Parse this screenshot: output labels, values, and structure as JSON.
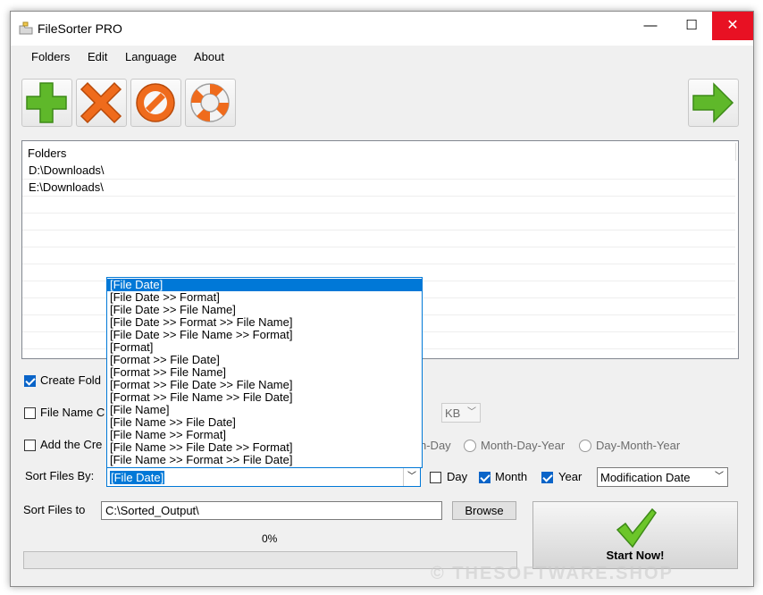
{
  "window": {
    "title": "FileSorter PRO",
    "min": "—",
    "max": "☐",
    "close": "✕"
  },
  "menu": [
    "Folders",
    "Edit",
    "Language",
    "About"
  ],
  "list": {
    "header": "Folders",
    "rows": [
      "D:\\Downloads\\",
      "E:\\Downloads\\"
    ]
  },
  "options": {
    "create_folders": {
      "label": "Create Fold",
      "checked": true
    },
    "file_name": {
      "label": "File Name C",
      "checked": false,
      "unit": "KB"
    },
    "add_created": {
      "label": "Add the Cre",
      "checked": false,
      "radio_partial": "h-Day",
      "radio_mdy": "Month-Day-Year",
      "radio_dmy": "Day-Month-Year"
    }
  },
  "sort_by": {
    "label": "Sort Files By:",
    "value": "[File Date]",
    "options": [
      "[File Date]",
      "[File Date >> Format]",
      "[File Date >> File Name]",
      "[File Date >> Format >> File Name]",
      "[File Date >> File Name >> Format]",
      "[Format]",
      "[Format >> File Date]",
      "[Format >> File Name]",
      "[Format >> File Date >> File Name]",
      "[Format >> File Name >> File Date]",
      "[File Name]",
      "[File Name >> File Date]",
      "[File Name >> Format]",
      "[File Name >> File Date >> Format]",
      "[File Name >> Format >> File Date]"
    ],
    "highlighted_index": 0
  },
  "date_parts": {
    "day": {
      "label": "Day",
      "checked": false
    },
    "month": {
      "label": "Month",
      "checked": true
    },
    "year": {
      "label": "Year",
      "checked": true
    }
  },
  "date_type": {
    "value": "Modification Date"
  },
  "sort_to": {
    "label": "Sort Files to",
    "value": "C:\\Sorted_Output\\",
    "browse": "Browse"
  },
  "progress": {
    "text": "0%",
    "value": 0
  },
  "start": {
    "label": "Start Now!"
  },
  "watermark": "© THESOFTWARE.SHOP",
  "colors": {
    "accent": "#0078d7",
    "close": "#e81123",
    "add": "#5fb82a",
    "delete": "#ef6b1c"
  }
}
